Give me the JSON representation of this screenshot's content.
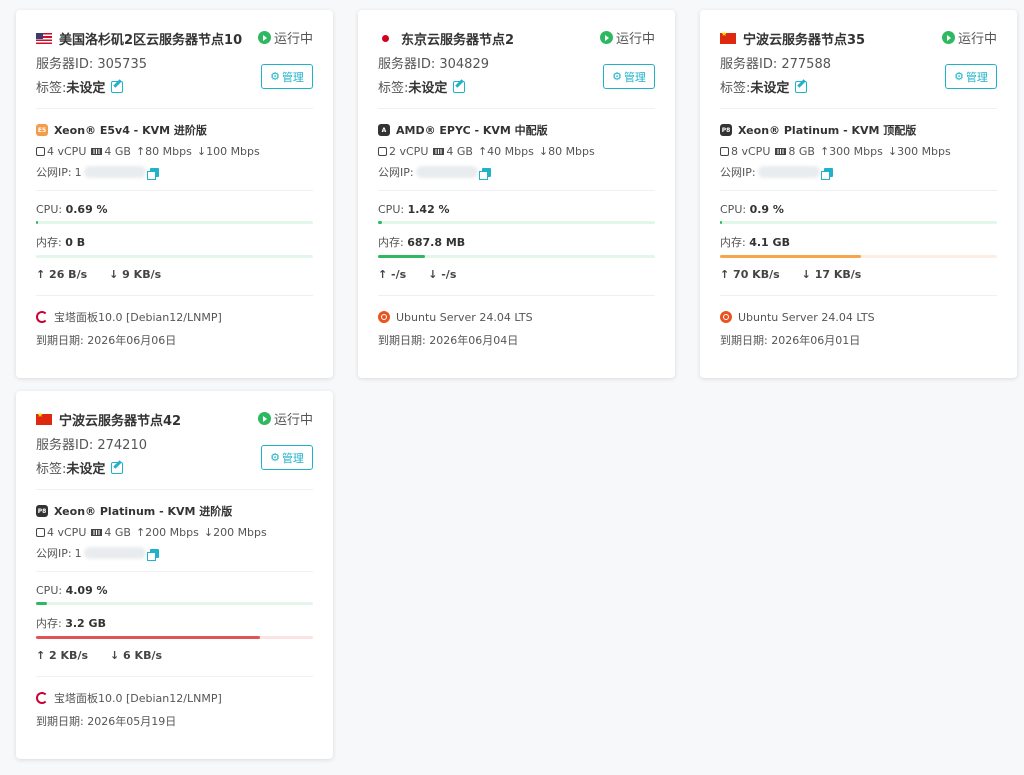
{
  "colors": {
    "accent": "#20b2c8",
    "running": "#2fb862",
    "mem_orange": "#f7a54a",
    "mem_red": "#e05454",
    "bar_green": "#2fb862"
  },
  "labels": {
    "status": "运行中",
    "manage": "管理",
    "server_id_prefix": "服务器ID: ",
    "tag_prefix": "标签: ",
    "tag_value": "未设定",
    "public_ip": "公网IP:",
    "cpu": "CPU:",
    "mem": "内存:",
    "expire_prefix": "到期日期: "
  },
  "servers": [
    {
      "flag": "us",
      "name": "美国洛杉矶2区云服务器节点10",
      "server_id": "305735",
      "cpu_badge": "E5",
      "cpu_model": "Xeon® E5v4 - KVM 进阶版",
      "vcpu": "4 vCPU",
      "ram": "4 GB",
      "up": "↑80 Mbps",
      "down": "↓100 Mbps",
      "ip": "1",
      "cpu_usage": "0.69 %",
      "cpu_pct": 0.69,
      "mem_usage": "0 B",
      "mem_pct": 0,
      "mem_color": "#2fb862",
      "tx": "↑ 26 B/s",
      "rx": "↓ 9 KB/s",
      "os": "宝塔面板10.0 [Debian12/LNMP]",
      "os_icon": "debian-icon",
      "expire": "2026年06月06日"
    },
    {
      "flag": "jp",
      "name": "东京云服务器节点2",
      "server_id": "304829",
      "cpu_badge": "A",
      "cpu_model": "AMD® EPYC - KVM 中配版",
      "vcpu": "2 vCPU",
      "ram": "4 GB",
      "up": "↑40 Mbps",
      "down": "↓80 Mbps",
      "ip": "",
      "cpu_usage": "1.42 %",
      "cpu_pct": 1.42,
      "mem_usage": "687.8 MB",
      "mem_pct": 17,
      "mem_color": "#2fb862",
      "tx": "↑ -/s",
      "rx": "↓ -/s",
      "os": "Ubuntu Server 24.04 LTS",
      "os_icon": "ubuntu-icon",
      "expire": "2026年06月04日"
    },
    {
      "flag": "cn",
      "name": "宁波云服务器节点35",
      "server_id": "277588",
      "cpu_badge": "P8",
      "cpu_model": "Xeon® Platinum - KVM 顶配版",
      "vcpu": "8 vCPU",
      "ram": "8 GB",
      "up": "↑300 Mbps",
      "down": "↓300 Mbps",
      "ip": "",
      "cpu_usage": "0.9 %",
      "cpu_pct": 0.9,
      "mem_usage": "4.1 GB",
      "mem_pct": 51,
      "mem_color": "#f7a54a",
      "tx": "↑ 70 KB/s",
      "rx": "↓ 17 KB/s",
      "os": "Ubuntu Server 24.04 LTS",
      "os_icon": "ubuntu-icon",
      "expire": "2026年06月01日"
    },
    {
      "flag": "cn",
      "name": "宁波云服务器节点42",
      "server_id": "274210",
      "cpu_badge": "P8",
      "cpu_model": "Xeon® Platinum - KVM 进阶版",
      "vcpu": "4 vCPU",
      "ram": "4 GB",
      "up": "↑200 Mbps",
      "down": "↓200 Mbps",
      "ip": "1",
      "cpu_usage": "4.09 %",
      "cpu_pct": 4.09,
      "mem_usage": "3.2 GB",
      "mem_pct": 81,
      "mem_color": "#e05454",
      "tx": "↑ 2 KB/s",
      "rx": "↓ 6 KB/s",
      "os": "宝塔面板10.0 [Debian12/LNMP]",
      "os_icon": "debian-icon",
      "expire": "2026年05月19日"
    }
  ]
}
